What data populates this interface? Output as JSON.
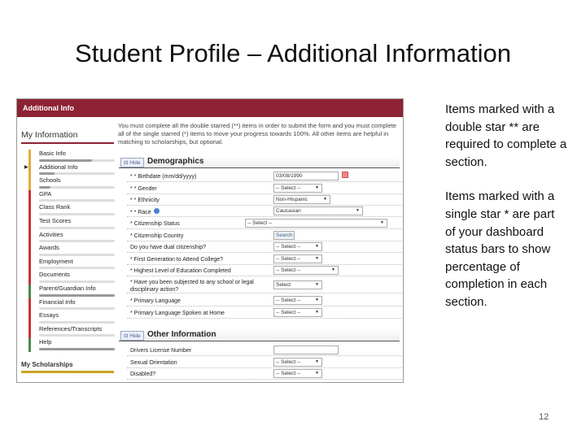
{
  "slide": {
    "title": "Student Profile – Additional Information",
    "page_number": "12",
    "notes": [
      "Items marked with a double star ** are required to complete a section.",
      "Items marked with a single star * are part of your dashboard status bars to show percentage of completion in each section."
    ]
  },
  "app": {
    "header": "Additional Info",
    "sidebar_title": "My Information",
    "sidebar_footer": "My Scholarships",
    "sidebar": [
      {
        "label": "Basic Info",
        "color": "#e8a93a",
        "progress": 0.7
      },
      {
        "label": "Additional Info",
        "color": "#e8a93a",
        "progress": 0.2,
        "current": true
      },
      {
        "label": "Schools",
        "color": "#e8a93a",
        "progress": 0.15
      },
      {
        "label": "GPA",
        "color": "#cc3333",
        "progress": 0
      },
      {
        "label": "Class Rank",
        "color": "#cc3333",
        "progress": 0
      },
      {
        "label": "Test Scores",
        "color": "#cc3333",
        "progress": 0
      },
      {
        "label": "Activities",
        "color": "#cc3333",
        "progress": 0
      },
      {
        "label": "Awards",
        "color": "#cc3333",
        "progress": 0
      },
      {
        "label": "Employment",
        "color": "#cc3333",
        "progress": 0
      },
      {
        "label": "Documents",
        "color": "#cc3333",
        "progress": 0
      },
      {
        "label": "Parent/Guardian Info",
        "color": "#4a8a4a",
        "progress": 1
      },
      {
        "label": "Financial Info",
        "color": "#cc3333",
        "progress": 0
      },
      {
        "label": "Essays",
        "color": "#cc3333",
        "progress": 0
      },
      {
        "label": "References/Transcripts",
        "color": "#cc3333",
        "progress": 0
      },
      {
        "label": "Help",
        "color": "#4a8a4a",
        "progress": 1
      }
    ],
    "intro": "You must complete all the double starred (**) items in order to submit the form and you must complete all of the single starred (*) items to move your progress towards 100%. All other items are helpful in matching to scholarships, but optional.",
    "hide_label": "Hide",
    "sections": [
      {
        "title": "Demographics",
        "rows": [
          {
            "label": "* * Birthdate (mm/dd/yyyy)",
            "type": "text",
            "value": "03/08/1990",
            "calendar": true
          },
          {
            "label": "* * Gender",
            "type": "select",
            "value": "-- Select --"
          },
          {
            "label": "* * Ethnicity",
            "type": "select",
            "value": "Non-Hispanic"
          },
          {
            "label": "* * Race",
            "type": "select",
            "value": "Caucasian",
            "help": true
          },
          {
            "label": "* Citizenship Status",
            "type": "select",
            "value": "-- Select --"
          },
          {
            "label": "* Citizenship Country",
            "type": "button",
            "value": "Search"
          },
          {
            "label": "Do you have dual citizenship?",
            "type": "select",
            "value": "-- Select --"
          },
          {
            "label": "* First Generation to Attend College?",
            "type": "select",
            "value": "-- Select --"
          },
          {
            "label": "* Highest Level of Education Completed",
            "type": "select",
            "value": "-- Select --"
          },
          {
            "label": "* Have you been subjected to any school or legal disciplinary action?",
            "type": "select",
            "value": "Select"
          },
          {
            "label": "* Primary Language",
            "type": "select",
            "value": "-- Select --"
          },
          {
            "label": "* Primary Language Spoken at Home",
            "type": "select",
            "value": "-- Select --"
          }
        ]
      },
      {
        "title": "Other Information",
        "rows": [
          {
            "label": "Drivers License Number",
            "type": "text",
            "value": ""
          },
          {
            "label": "Sexual Orientation",
            "type": "select",
            "value": "-- Select --"
          },
          {
            "label": "Disabled?",
            "type": "select",
            "value": "-- Select --"
          }
        ]
      }
    ]
  }
}
